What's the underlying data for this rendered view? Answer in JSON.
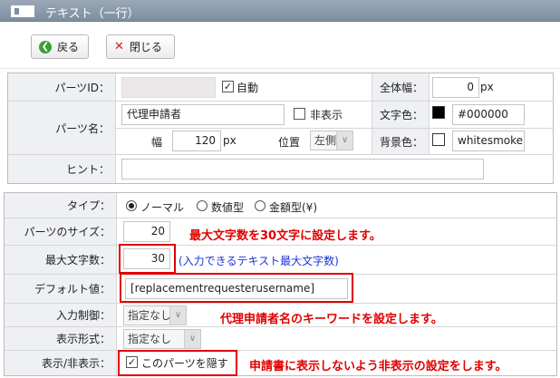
{
  "window": {
    "title": "テキスト（一行）",
    "icon": "text-field-icon"
  },
  "toolbar": {
    "back_label": "戻る",
    "close_label": "閉じる",
    "back_icon": "back-arrow-icon",
    "close_icon": "close-x-icon"
  },
  "parts": {
    "id_label": "パーツID：",
    "id_value": "",
    "auto_label": "自動",
    "auto_checked": true,
    "width_total_label": "全体幅：",
    "width_total_value": "0",
    "width_total_unit": "px",
    "name_label": "パーツ名：",
    "name_value": "代理申請者",
    "hidden_label": "非表示",
    "hidden_checked": false,
    "text_color_label": "文字色：",
    "text_color_value": "#000000",
    "width_label": "幅",
    "width_value": "120",
    "width_unit": "px",
    "position_label": "位置",
    "position_value": "左側",
    "bg_label": "背景色：",
    "bg_value": "whitesmoke",
    "hint_label": "ヒント：",
    "hint_value": ""
  },
  "settings": {
    "type_label": "タイプ：",
    "type_options": [
      "ノーマル",
      "数値型",
      "金額型(¥)"
    ],
    "type_selected": "ノーマル",
    "size_label": "パーツのサイズ：",
    "size_value": "20",
    "maxlen_label": "最大文字数：",
    "maxlen_value": "30",
    "maxlen_hint": "(入力できるテキスト最大文字数)",
    "default_label": "デフォルト値：",
    "default_value": "[replacementrequesterusername]",
    "input_ctrl_label": "入力制御：",
    "input_ctrl_value": "指定なし",
    "display_format_label": "表示形式：",
    "display_format_value": "指定なし",
    "visibility_label": "表示/非表示：",
    "hide_parts_label": "このパーツを隠す",
    "hide_parts_checked": true
  },
  "annotations": {
    "maxlen_note": "最大文字数を30文字に設定します。",
    "keyword_note": "代理申請者名のキーワードを設定します。",
    "hide_note": "申請書に表示しないよう非表示の設定をします。"
  },
  "colors": {
    "annotation": "#e00000",
    "hint_blue": "#1a33d9",
    "titlebar": "#8797a8"
  }
}
